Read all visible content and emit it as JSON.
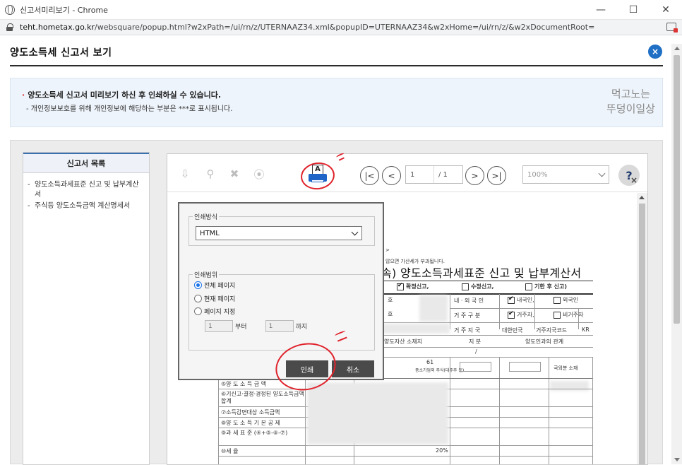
{
  "window": {
    "title": "신고서미리보기 - Chrome",
    "url_host": "teht.hometax.go.kr",
    "url_path": "/websquare/popup.html?w2xPath=/ui/rn/z/UTERNAAZ34.xml&popupID=UTERNAAZ34&w2xHome=/ui/rn/z/&w2xDocumentRoot=",
    "controls": {
      "minimize": "—",
      "maximize": "☐",
      "close": "✕"
    }
  },
  "header": {
    "title": "양도소득세 신고서 보기",
    "close_symbol": "×"
  },
  "info": {
    "line1": "양도소득세 신고서 미리보기 하신 후 인쇄하실 수 있습니다.",
    "line2": "- 개인정보보호를 위해 개인정보에 해당하는 부분은  ***로 표시됩니다.",
    "watermark_line1": "먹고노는",
    "watermark_line2": "뚜덩이일상"
  },
  "toc": {
    "title": "신고서 목록",
    "items": [
      "양도소득과세표준 신고 및 납부계산서",
      "주식등 양도소득금액 계산명세서"
    ]
  },
  "viewer": {
    "toolbar": {
      "icons": [
        "export-icon",
        "pdf-icon",
        "excel-icon",
        "hwp-icon",
        "print-icon"
      ],
      "print_glyph": "A",
      "first": "|<",
      "prev": "<",
      "next": ">",
      "last": ">|",
      "page_current": "1",
      "page_total": "/ 1",
      "zoom": "100%",
      "help": "?"
    },
    "doc": {
      "note1": ">",
      "note2": "않으면 가산세가 부과됩니다.",
      "form_title": "속) 양도소득과세표준 신고 및 납부계산서",
      "check_final": "확정신고,",
      "check_amend": "수정신고,",
      "check_late": "기한 후 신고)",
      "row_ho1": "호",
      "row_ho2": "호",
      "natl_label": "내 · 외 국 인",
      "natl_domestic": "내국인,",
      "natl_foreign": "외국인",
      "res_label": "거 주 구 분",
      "res_resident": "거주자,",
      "res_nonresident": "비거주자",
      "country_label": "거 주 지 국",
      "country_value": "대한민국",
      "country_code_label": "거주지국코드",
      "country_code": "KR",
      "asset_loc": "양도자산 소재지",
      "division": "지  분",
      "relation": "양도인과의 관계",
      "slash": "/",
      "code61": "61",
      "code61_desc": "중소기업외 주식(대주주 등)",
      "foreign_located": "국외분 소재",
      "rows": [
        "⑤양 도 소 득 금 액",
        "⑥기신고·결정·경정된 양도소득금액 합계",
        "⑦소득감면대상 소득금액",
        "⑧양 도 소 득 기 본 공 제",
        "⑨과 세 표 준 (④+⑤-⑥-⑦)",
        "⑩세 율"
      ],
      "rate": "20%"
    }
  },
  "print_dialog": {
    "method_legend": "인쇄방식",
    "method_value": "HTML",
    "range_legend": "인쇄범위",
    "opt_all": "전체 페이지",
    "opt_current": "현재 페이지",
    "opt_specify": "페이지 지정",
    "from_value": "1",
    "from_label": "부터",
    "to_value": "1",
    "to_label": "까지",
    "print_button": "인쇄",
    "cancel_button": "취소"
  }
}
